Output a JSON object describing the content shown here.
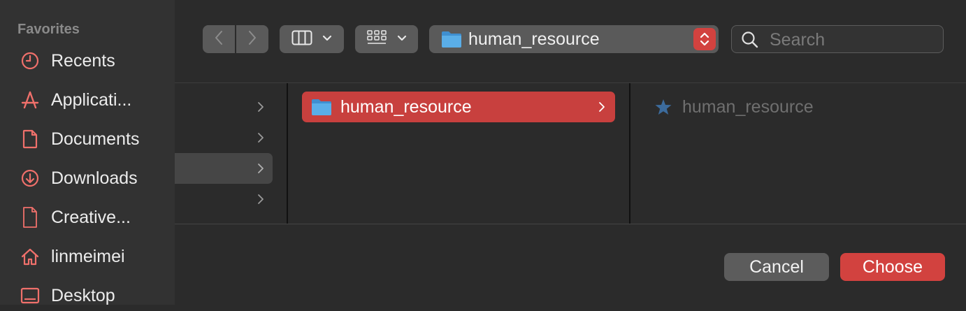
{
  "sidebar": {
    "heading": "Favorites",
    "items": [
      {
        "label": "Recents",
        "icon": "clock-icon"
      },
      {
        "label": "Applicati...",
        "icon": "applications-icon"
      },
      {
        "label": "Documents",
        "icon": "document-icon"
      },
      {
        "label": "Downloads",
        "icon": "download-icon"
      },
      {
        "label": "Creative...",
        "icon": "file-icon"
      },
      {
        "label": "linmeimei",
        "icon": "home-icon"
      },
      {
        "label": "Desktop",
        "icon": "desktop-icon"
      }
    ]
  },
  "toolbar": {
    "path_label": "human_resource",
    "search_placeholder": "Search"
  },
  "browser": {
    "selected_folder": "human_resource",
    "preview_label": "human_resource"
  },
  "buttons": {
    "cancel": "Cancel",
    "choose": "Choose"
  },
  "colors": {
    "accent": "#d2423f",
    "sidebar_icon": "#f0706b",
    "folder": "#5aaee8"
  }
}
